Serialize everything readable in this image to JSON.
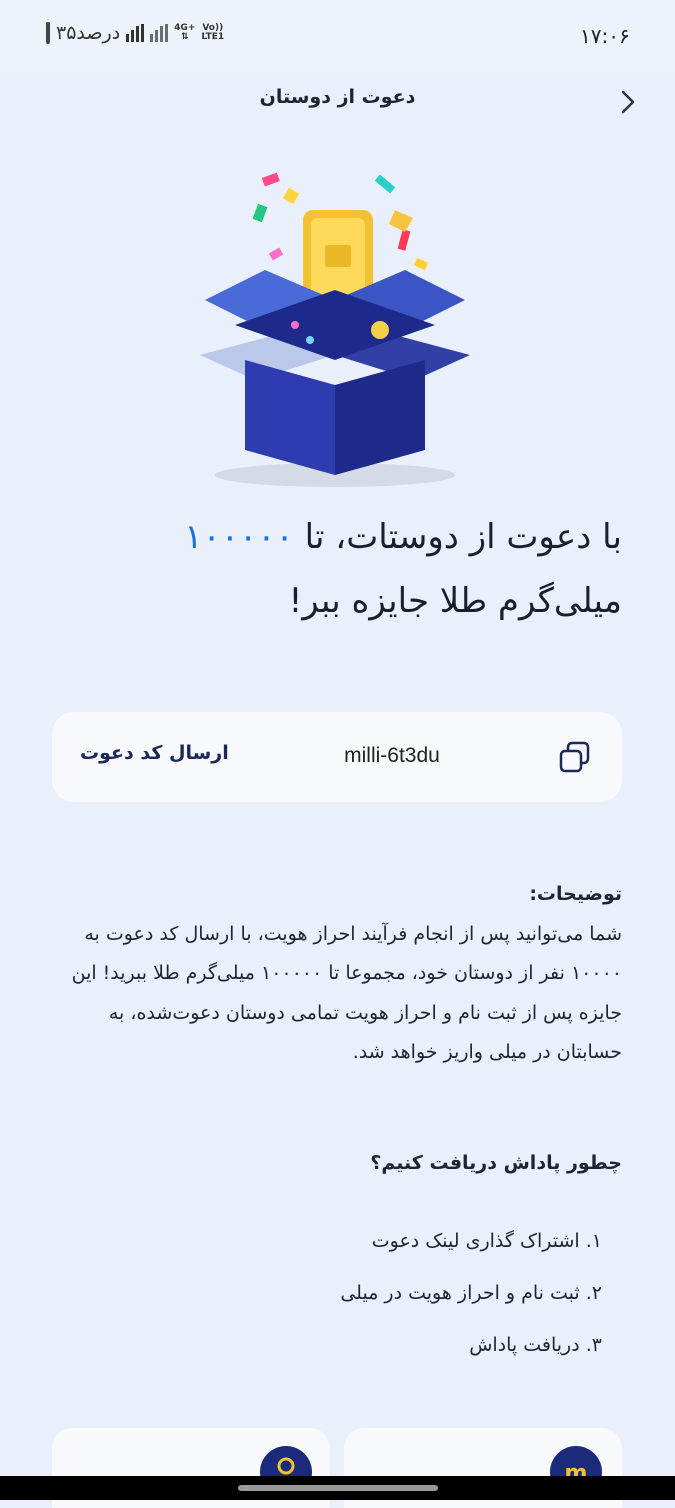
{
  "status_bar": {
    "time": "۱۷:۰۶",
    "battery_text": "۳۵درصد",
    "network_top": "4G+",
    "network_bottom": "LTE1",
    "volte": "Vo))"
  },
  "header": {
    "title": "دعوت از دوستان",
    "back_icon": "chevron-right-icon"
  },
  "hero": {
    "illustration": "gift-box-gold-bar-illustration"
  },
  "headline": {
    "part1": "با دعوت از دوستات، تا ",
    "amount": "۱۰۰۰۰۰",
    "part2": "میلی‌گرم طلا جایزه ببر!"
  },
  "invite": {
    "send_label": "ارسال کد دعوت",
    "code": "milli-6t3du",
    "copy_icon": "copy-icon"
  },
  "description": {
    "title": "توضیحات:",
    "body": "شما می‌توانید پس از انجام فرآیند احراز هویت، با ارسال کد دعوت به ۱۰۰۰۰ نفر از دوستان خود، مجموعا تا ۱۰۰۰۰۰ میلی‌گرم طلا ببرید! این جایزه پس از ثبت نام و احراز هویت تمامی دوستان دعوت‌شده، به حسابتان در میلی واریز خواهد شد."
  },
  "how_to": {
    "title": "چطور پاداش دریافت کنیم؟",
    "steps": [
      "۱. اشتراک گذاری لینک دعوت",
      "۲. ثبت نام و احراز هویت در میلی",
      "۳. دریافت پاداش"
    ]
  },
  "colors": {
    "background": "#e9f0fb",
    "accent": "#1a6fe0",
    "navy": "#1b2756",
    "card": "#f7f9fd"
  }
}
